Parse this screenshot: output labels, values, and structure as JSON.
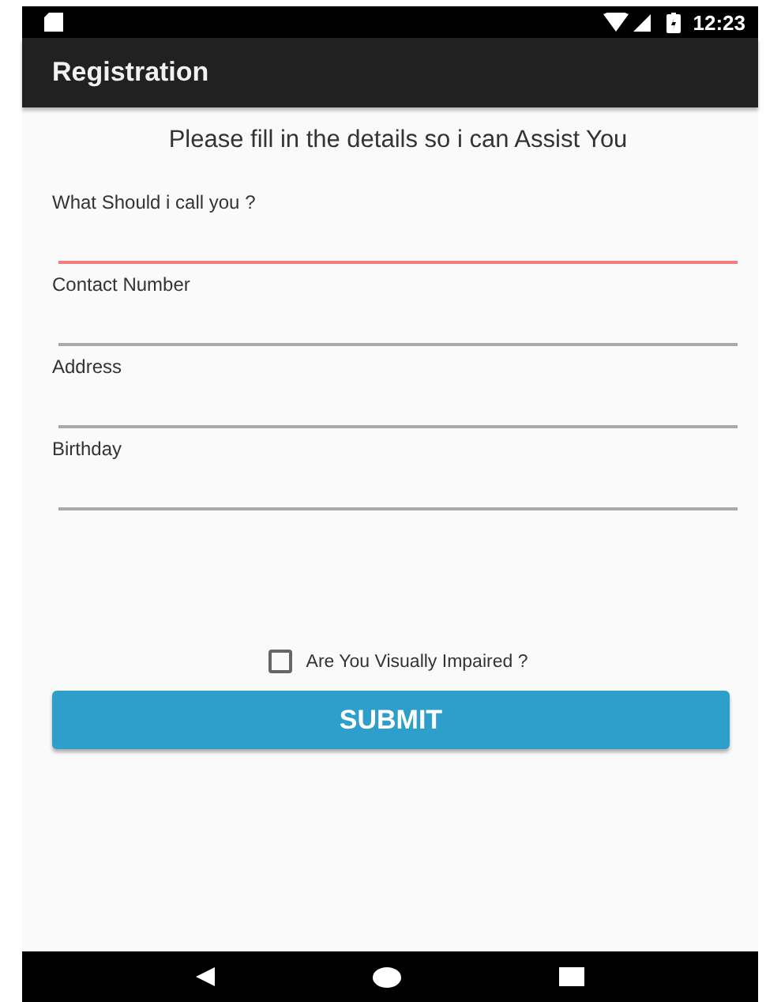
{
  "status_bar": {
    "time": "12:23"
  },
  "app_bar": {
    "title": "Registration"
  },
  "form": {
    "heading": "Please fill in the details so i can Assist You",
    "fields": [
      {
        "label": "What Should i call you ?",
        "active": true
      },
      {
        "label": "Contact Number",
        "active": false
      },
      {
        "label": "Address",
        "active": false
      },
      {
        "label": "Birthday",
        "active": false
      }
    ],
    "checkbox": {
      "label": "Are You Visually Impaired ?",
      "checked": false
    },
    "submit": "SUBMIT"
  }
}
